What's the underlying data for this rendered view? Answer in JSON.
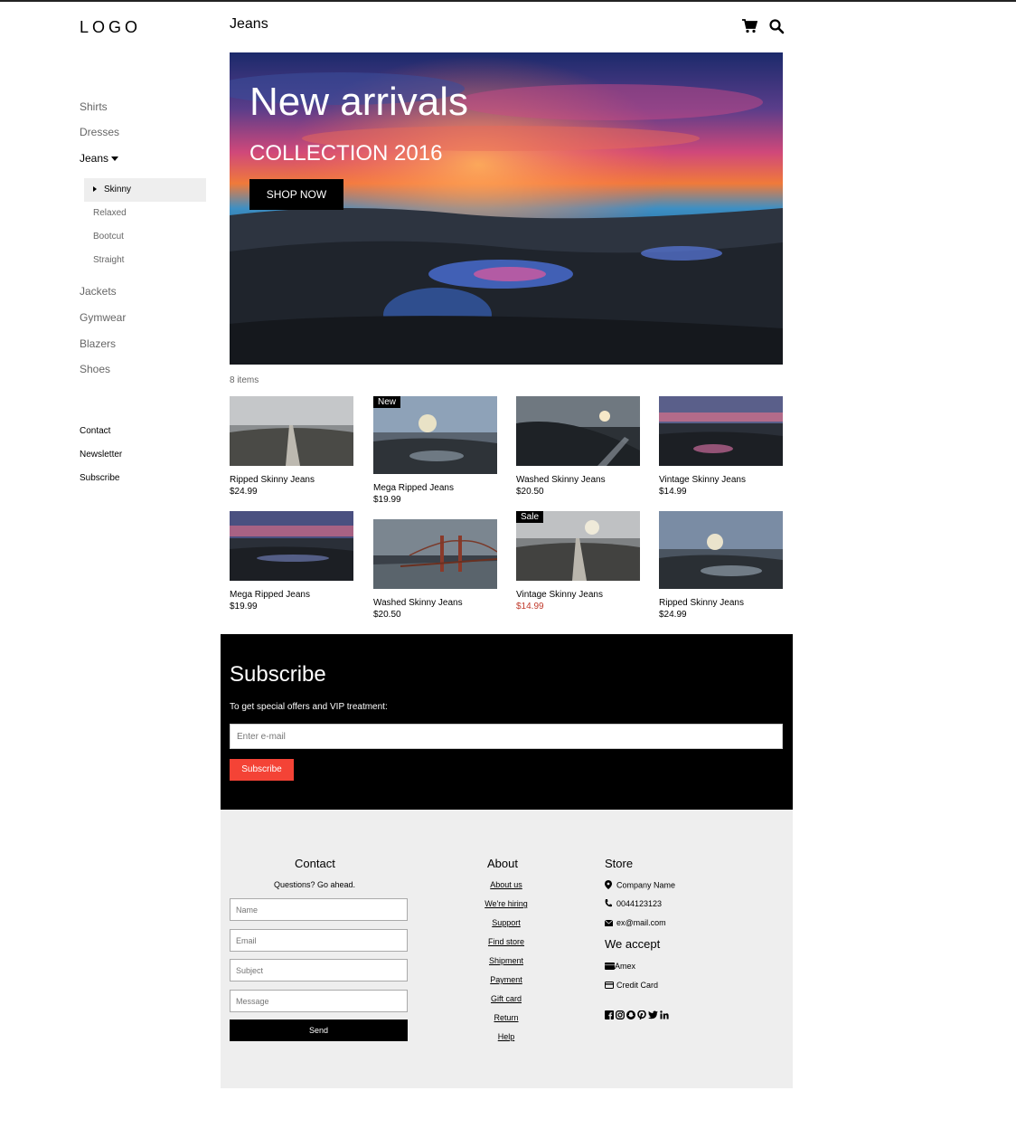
{
  "header": {
    "logo": "LOGO",
    "page_title": "Jeans"
  },
  "sidebar": {
    "categories": [
      "Shirts",
      "Dresses",
      "Jeans",
      "Jackets",
      "Gymwear",
      "Blazers",
      "Shoes"
    ],
    "active_category": "Jeans",
    "jeans_subcategories": [
      "Skinny",
      "Relaxed",
      "Bootcut",
      "Straight"
    ],
    "active_subcategory": "Skinny",
    "links": [
      "Contact",
      "Newsletter",
      "Subscribe"
    ]
  },
  "hero": {
    "title": "New arrivals",
    "subtitle": "COLLECTION 2016",
    "button": "SHOP NOW"
  },
  "items_count": "8 items",
  "products": [
    {
      "name": "Ripped Skinny Jeans",
      "price": "$24.99",
      "badge": "",
      "image": "city-road"
    },
    {
      "name": "Mega Ripped Jeans",
      "price": "$19.99",
      "badge": "New",
      "image": "rocky-coast"
    },
    {
      "name": "Washed Skinny Jeans",
      "price": "$20.50",
      "badge": "",
      "image": "dark-slope"
    },
    {
      "name": "Vintage Skinny Jeans",
      "price": "$14.99",
      "badge": "",
      "image": "sunset-rocks"
    },
    {
      "name": "Mega Ripped Jeans",
      "price": "$19.99",
      "badge": "",
      "image": "sunset-rocks"
    },
    {
      "name": "Washed Skinny Jeans",
      "price": "$20.50",
      "badge": "",
      "image": "golden-gate"
    },
    {
      "name": "Vintage Skinny Jeans",
      "price": "$14.99",
      "badge": "Sale",
      "image": "city-road",
      "sale_price": true
    },
    {
      "name": "Ripped Skinny Jeans",
      "price": "$24.99",
      "badge": "",
      "image": "rocky-coast"
    }
  ],
  "subscribe": {
    "title": "Subscribe",
    "text": "To get special offers and VIP treatment:",
    "email_placeholder": "Enter e-mail",
    "button": "Subscribe",
    "button_color": "#f44336"
  },
  "footer": {
    "contact": {
      "title": "Contact",
      "text": "Questions? Go ahead.",
      "name_placeholder": "Name",
      "email_placeholder": "Email",
      "subject_placeholder": "Subject",
      "message_placeholder": "Message",
      "send": "Send"
    },
    "about": {
      "title": "About",
      "links": [
        "About us",
        "We're hiring",
        "Support",
        "Find store",
        "Shipment",
        "Payment",
        "Gift card",
        "Return",
        "Help"
      ]
    },
    "store": {
      "title": "Store",
      "company": "Company Name",
      "phone": "0044123123",
      "email": "ex@mail.com",
      "accept_title": "We accept",
      "payments": [
        "Amex",
        "Credit Card"
      ]
    },
    "social_icons": [
      "facebook-icon",
      "instagram-icon",
      "snapchat-icon",
      "pinterest-icon",
      "twitter-icon",
      "linkedin-icon"
    ]
  }
}
